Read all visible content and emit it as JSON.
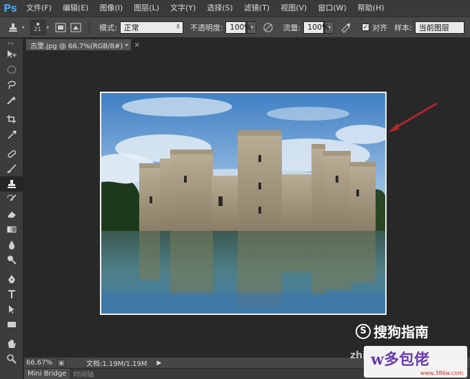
{
  "app": {
    "logo": "Ps"
  },
  "menubar": {
    "items": [
      {
        "label": "文件(F)"
      },
      {
        "label": "编辑(E)"
      },
      {
        "label": "图像(I)"
      },
      {
        "label": "图层(L)"
      },
      {
        "label": "文字(Y)"
      },
      {
        "label": "选择(S)"
      },
      {
        "label": "滤镜(T)"
      },
      {
        "label": "视图(V)"
      },
      {
        "label": "窗口(W)"
      },
      {
        "label": "帮助(H)"
      }
    ]
  },
  "options": {
    "brush_size": "21",
    "mode_label": "模式:",
    "mode_value": "正常",
    "opacity_label": "不透明度:",
    "opacity_value": "100%",
    "flow_label": "流量:",
    "flow_value": "100%",
    "aligned_label": "对齐",
    "aligned_checked": true,
    "sample_label": "样本:",
    "sample_value": "当前图层"
  },
  "document": {
    "tab_title": "古堡.jpg @ 66.7%(RGB/8#) *",
    "close_glyph": "×"
  },
  "status": {
    "zoom": "66.67%",
    "doc_info": "文档:1.19M/1.19M"
  },
  "bottom_panel": {
    "tabs": [
      {
        "label": "Mini Bridge"
      },
      {
        "label": "时间轴"
      }
    ]
  },
  "watermarks": {
    "sogou_circle": "S",
    "sogou_text": "搜狗指南",
    "zhi": "zhi",
    "badge_title": "w多包佬",
    "badge_url": "www.386w.com"
  },
  "colors": {
    "accent_ps": "#4aa3e6",
    "canvas_bg": "#282828",
    "sky": "#5d93cc",
    "arrow": "#b3262a"
  },
  "tools": [
    {
      "icon": "move-tool-icon"
    },
    {
      "icon": "marquee-tool-icon"
    },
    {
      "icon": "lasso-tool-icon"
    },
    {
      "icon": "quick-selection-tool-icon"
    },
    {
      "icon": "crop-tool-icon"
    },
    {
      "icon": "eyedropper-tool-icon"
    },
    {
      "icon": "healing-brush-tool-icon"
    },
    {
      "icon": "brush-tool-icon"
    },
    {
      "icon": "clone-stamp-tool-icon"
    },
    {
      "icon": "history-brush-tool-icon"
    },
    {
      "icon": "eraser-tool-icon"
    },
    {
      "icon": "gradient-tool-icon"
    },
    {
      "icon": "blur-tool-icon"
    },
    {
      "icon": "dodge-tool-icon"
    },
    {
      "icon": "pen-tool-icon"
    },
    {
      "icon": "type-tool-icon"
    },
    {
      "icon": "path-selection-tool-icon"
    },
    {
      "icon": "rectangle-tool-icon"
    },
    {
      "icon": "hand-tool-icon"
    },
    {
      "icon": "zoom-tool-icon"
    }
  ]
}
